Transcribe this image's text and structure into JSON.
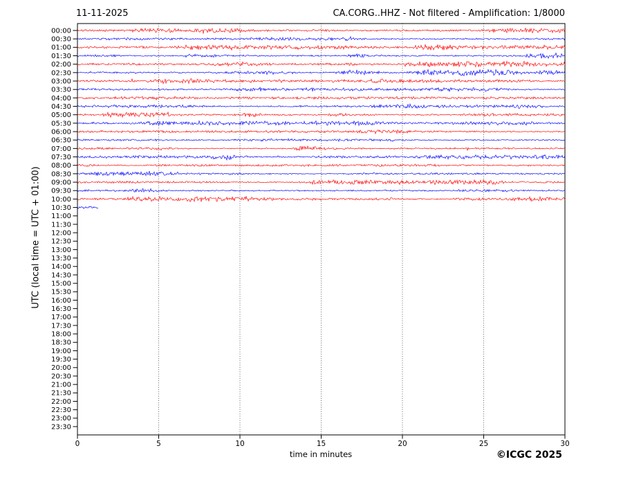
{
  "header": {
    "date": "11-11-2025",
    "title": "CA.CORG..HHZ - Not filtered - Amplification: 1/8000"
  },
  "axes": {
    "y_label": "UTC (local time = UTC + 01:00)",
    "x_label": "time in minutes",
    "x_ticks": [
      0,
      5,
      10,
      15,
      20,
      25,
      30
    ],
    "x_grid_ticks": [
      5,
      10,
      15,
      20,
      25
    ],
    "x_range": [
      0,
      30
    ],
    "y_tick_labels": [
      "00:00",
      "00:30",
      "01:00",
      "01:30",
      "02:00",
      "02:30",
      "03:00",
      "03:30",
      "04:00",
      "04:30",
      "05:00",
      "05:30",
      "06:00",
      "06:30",
      "07:00",
      "07:30",
      "08:00",
      "08:30",
      "09:00",
      "09:30",
      "10:00",
      "10:30",
      "11:00",
      "11:30",
      "12:00",
      "12:30",
      "13:00",
      "13:30",
      "14:00",
      "14:30",
      "15:00",
      "15:30",
      "16:00",
      "16:30",
      "17:00",
      "17:30",
      "18:00",
      "18:30",
      "19:00",
      "19:30",
      "20:00",
      "20:30",
      "21:00",
      "21:30",
      "22:00",
      "22:30",
      "23:00",
      "23:30"
    ]
  },
  "footer": {
    "copyright": "©ICGC 2025"
  },
  "colors": {
    "trace_red": "#ff0000",
    "trace_blue": "#0000ff",
    "grid": "#3b3b3b",
    "frame": "#000000",
    "background": "#ffffff"
  },
  "chart_data": {
    "type": "line",
    "subtype": "helicorder-seismogram",
    "title": "CA.CORG..HHZ - Not filtered - Amplification: 1/8000",
    "date": "11-11-2025",
    "xlabel": "time in minutes",
    "ylabel": "UTC (local time = UTC + 01:00)",
    "xlim": [
      0,
      30
    ],
    "minutes_per_row": 30,
    "grid": "vertical dotted lines at 5,10,15,20,25 minutes",
    "legend_position": "none",
    "amplitude_note": "low-amplitude unfiltered background noise with small intermittent bursts on each recorded line",
    "rows": [
      {
        "label": "00:00",
        "color": "red",
        "start_min": 0,
        "end_min": 30
      },
      {
        "label": "00:30",
        "color": "blue",
        "start_min": 0,
        "end_min": 30
      },
      {
        "label": "01:00",
        "color": "red",
        "start_min": 0,
        "end_min": 30
      },
      {
        "label": "01:30",
        "color": "blue",
        "start_min": 0,
        "end_min": 30
      },
      {
        "label": "02:00",
        "color": "red",
        "start_min": 0,
        "end_min": 30
      },
      {
        "label": "02:30",
        "color": "blue",
        "start_min": 0,
        "end_min": 30
      },
      {
        "label": "03:00",
        "color": "red",
        "start_min": 0,
        "end_min": 30
      },
      {
        "label": "03:30",
        "color": "blue",
        "start_min": 0,
        "end_min": 30
      },
      {
        "label": "04:00",
        "color": "red",
        "start_min": 0,
        "end_min": 30
      },
      {
        "label": "04:30",
        "color": "blue",
        "start_min": 0,
        "end_min": 30
      },
      {
        "label": "05:00",
        "color": "red",
        "start_min": 0,
        "end_min": 30
      },
      {
        "label": "05:30",
        "color": "blue",
        "start_min": 0,
        "end_min": 30
      },
      {
        "label": "06:00",
        "color": "red",
        "start_min": 0,
        "end_min": 30
      },
      {
        "label": "06:30",
        "color": "blue",
        "start_min": 0,
        "end_min": 30
      },
      {
        "label": "07:00",
        "color": "red",
        "start_min": 0,
        "end_min": 30
      },
      {
        "label": "07:30",
        "color": "blue",
        "start_min": 0,
        "end_min": 30
      },
      {
        "label": "08:00",
        "color": "red",
        "start_min": 0,
        "end_min": 30
      },
      {
        "label": "08:30",
        "color": "blue",
        "start_min": 0,
        "end_min": 30
      },
      {
        "label": "09:00",
        "color": "red",
        "start_min": 0,
        "end_min": 30
      },
      {
        "label": "09:30",
        "color": "blue",
        "start_min": 0,
        "end_min": 30
      },
      {
        "label": "10:00",
        "color": "red",
        "start_min": 0,
        "end_min": 30
      },
      {
        "label": "10:30",
        "color": "blue",
        "start_min": 0,
        "end_min": 1.3
      }
    ]
  }
}
